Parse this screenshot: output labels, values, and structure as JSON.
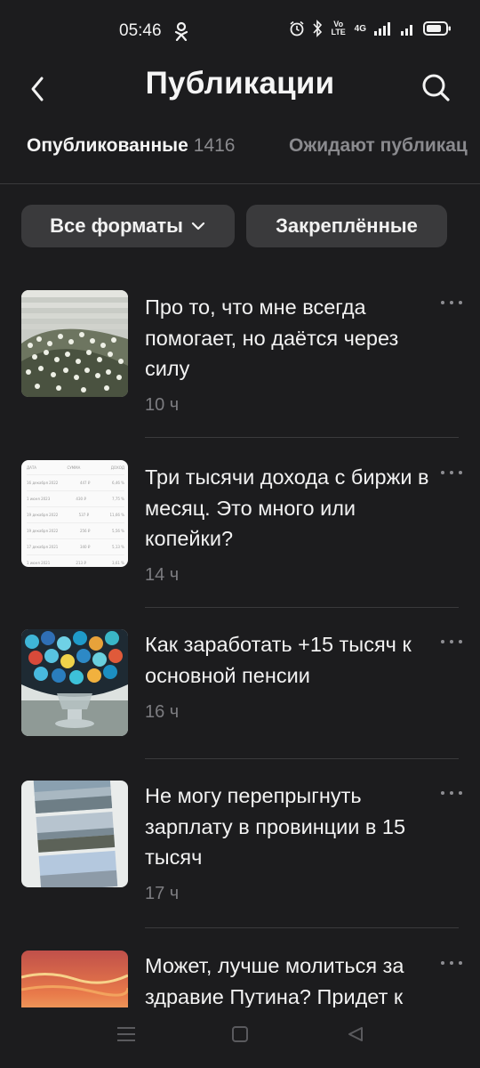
{
  "status_bar": {
    "time": "05:46",
    "network_label": "4G",
    "volte_label": "Vo LTE",
    "battery_level": 0.8
  },
  "header": {
    "title": "Публикации",
    "back_icon": "chevron-left-icon",
    "search_icon": "search-icon"
  },
  "tabs": [
    {
      "label": "Опубликованные",
      "count": "1416",
      "active": true
    },
    {
      "label": "Ожидают публикац",
      "active": false
    }
  ],
  "filters": {
    "formats_label": "Все форматы",
    "pinned_label": "Закреплённые"
  },
  "posts": [
    {
      "title": "Про то, что мне всегда помогает, но даётся через силу",
      "time": "10 ч",
      "thumb": "white-flowers-photo"
    },
    {
      "title": "Три тысячи дохода с биржи в месяц. Это много или копейки?",
      "time": "14 ч",
      "thumb": "income-table-screenshot",
      "table": {
        "headers": [
          "ДАТА",
          "СУММА",
          "ДОХОД"
        ],
        "rows": [
          [
            "16 декабря 2022",
            "447 ₽",
            "6,46 %"
          ],
          [
            "1 июня 2023",
            "430 ₽",
            "7,75 %"
          ],
          [
            "19 декабря 2022",
            "537 ₽",
            "11,66 %"
          ],
          [
            "19 декабря 2022",
            "256 ₽",
            "5,56 %"
          ],
          [
            "17 декабря 2021",
            "340 ₽",
            "5,13 %"
          ],
          [
            "1 июня 2021",
            "213 ₽",
            "3,61 %"
          ]
        ]
      }
    },
    {
      "title": "Как заработать +15 тысяч к основной пенсии",
      "time": "16 ч",
      "thumb": "candy-bowl-photo"
    },
    {
      "title": "Не могу перепрыгнуть зарплату в провинции в 15 тысяч",
      "time": "17 ч",
      "thumb": "seaside-photos"
    },
    {
      "title": "Может, лучше молиться за здравие Путина? Придет к",
      "time": "",
      "thumb": "sunset-painting"
    }
  ],
  "colors": {
    "background": "#1c1c1e",
    "chip": "#3a3a3c",
    "muted": "#7c7c80",
    "divider": "#3a3a3c"
  }
}
